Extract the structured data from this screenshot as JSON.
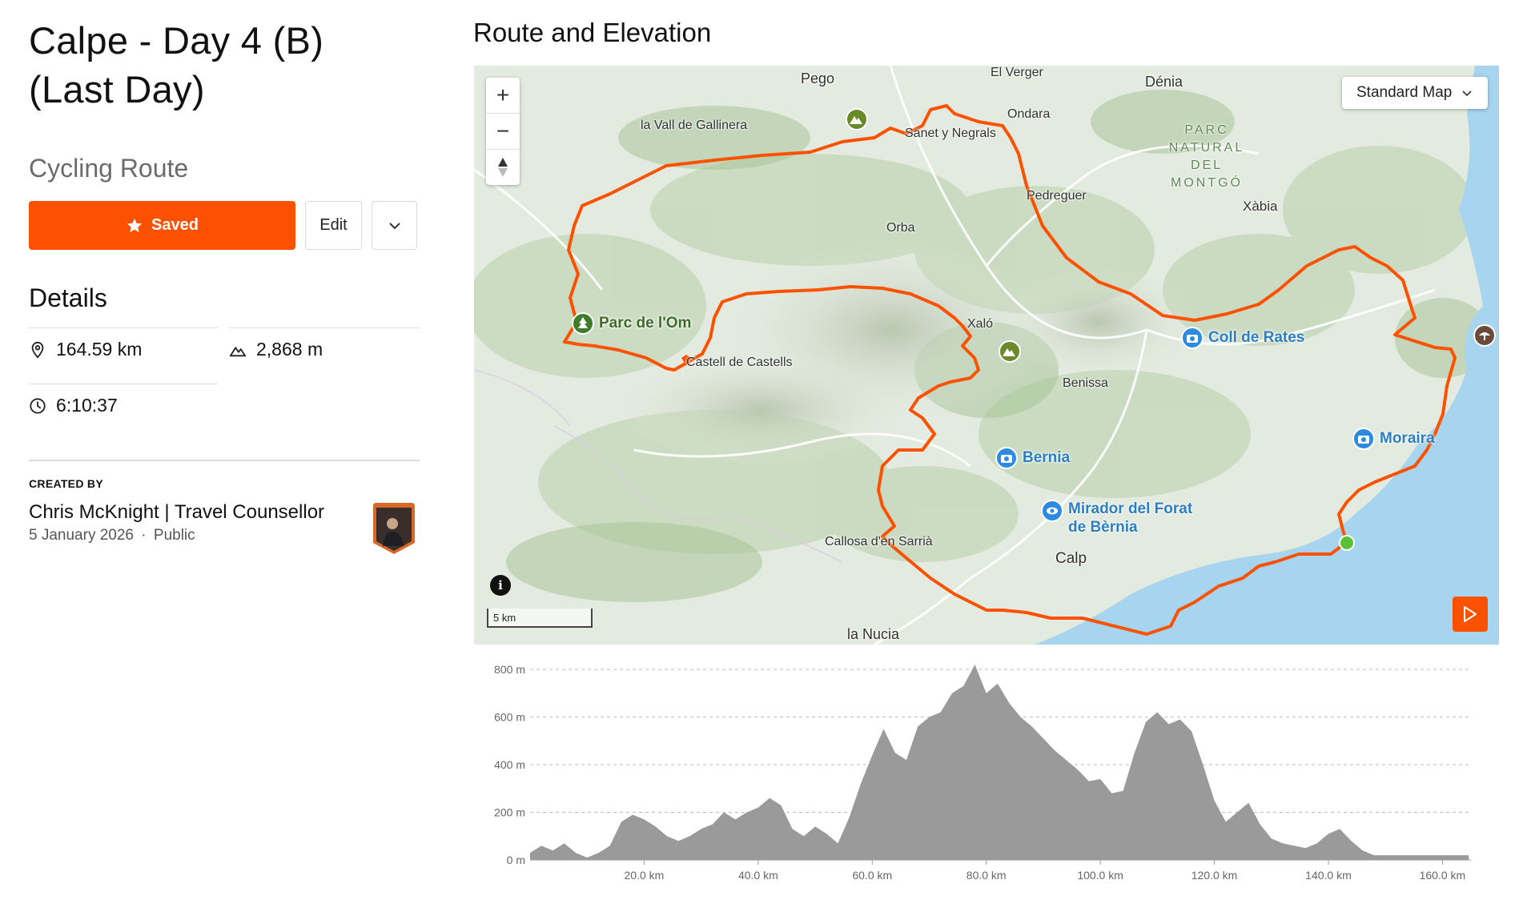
{
  "route": {
    "title_line1": "Calpe - Day 4 (B)",
    "title_line2": "(Last Day)",
    "type": "Cycling Route"
  },
  "actions": {
    "saved_label": "Saved",
    "edit_label": "Edit"
  },
  "details": {
    "heading": "Details",
    "distance": "164.59 km",
    "elevation_gain": "2,868 m",
    "moving_time": "6:10:37"
  },
  "creator": {
    "label": "CREATED BY",
    "name": "Chris McKnight | Travel Counsellor",
    "date": "5 January 2026",
    "separator": "·",
    "visibility": "Public"
  },
  "section_title": "Route and Elevation",
  "map": {
    "map_type": "Standard Map",
    "scale_label": "5 km",
    "zoom_in": "+",
    "zoom_out": "−",
    "place_labels": [
      "Pego",
      "El Verger",
      "Dénia",
      "la Vall de Gallinera",
      "Ondara",
      "Sanet y Negrals",
      "Pedreguer",
      "Xàbia",
      "Orba",
      "Xaló",
      "Benissa",
      "Castell de Castells",
      "Callosa d'en Sarrià",
      "Calp",
      "la Nucia"
    ],
    "park_label": "PARC NATURAL DEL MONTGÓ",
    "pois": [
      "Parc de l'Om",
      "Coll de Rates",
      "Moraira",
      "Bernia",
      "Mirador del Forat de Bèrnia"
    ],
    "colors": {
      "route": "#fc5200",
      "water": "#a7d4ee",
      "start": "#5ac239"
    }
  },
  "chart_data": {
    "type": "area",
    "title": "",
    "xlabel": "",
    "ylabel": "",
    "x_unit": "km",
    "y_unit": "m",
    "xlim": [
      0,
      165
    ],
    "ylim": [
      0,
      800
    ],
    "y_ticks": [
      "0 m",
      "200 m",
      "400 m",
      "600 m",
      "800 m"
    ],
    "x_ticks": [
      "20.0 km",
      "40.0 km",
      "60.0 km",
      "80.0 km",
      "100.0 km",
      "120.0 km",
      "140.0 km",
      "160.0 km"
    ],
    "grid": true,
    "color": "#9a9a9a",
    "x": [
      0,
      2,
      4,
      6,
      8,
      10,
      12,
      14,
      16,
      18,
      20,
      22,
      24,
      26,
      28,
      30,
      32,
      34,
      36,
      38,
      40,
      42,
      44,
      46,
      48,
      50,
      52,
      54,
      56,
      58,
      60,
      62,
      64,
      66,
      68,
      70,
      72,
      74,
      76,
      78,
      80,
      82,
      84,
      86,
      88,
      90,
      92,
      94,
      96,
      98,
      100,
      102,
      104,
      106,
      108,
      110,
      112,
      114,
      116,
      118,
      120,
      122,
      124,
      126,
      128,
      130,
      132,
      134,
      136,
      138,
      140,
      142,
      144,
      146,
      148,
      150,
      152,
      154,
      156,
      158,
      160,
      162,
      164.6
    ],
    "y": [
      30,
      60,
      40,
      70,
      30,
      10,
      30,
      60,
      160,
      190,
      170,
      140,
      100,
      80,
      100,
      130,
      150,
      200,
      170,
      200,
      220,
      260,
      230,
      130,
      100,
      140,
      110,
      70,
      180,
      320,
      440,
      550,
      450,
      420,
      560,
      600,
      620,
      700,
      730,
      820,
      700,
      740,
      660,
      600,
      560,
      510,
      460,
      420,
      380,
      330,
      340,
      280,
      290,
      450,
      580,
      620,
      570,
      590,
      540,
      400,
      250,
      160,
      200,
      240,
      150,
      90,
      70,
      60,
      50,
      70,
      110,
      130,
      80,
      40,
      20
    ]
  }
}
